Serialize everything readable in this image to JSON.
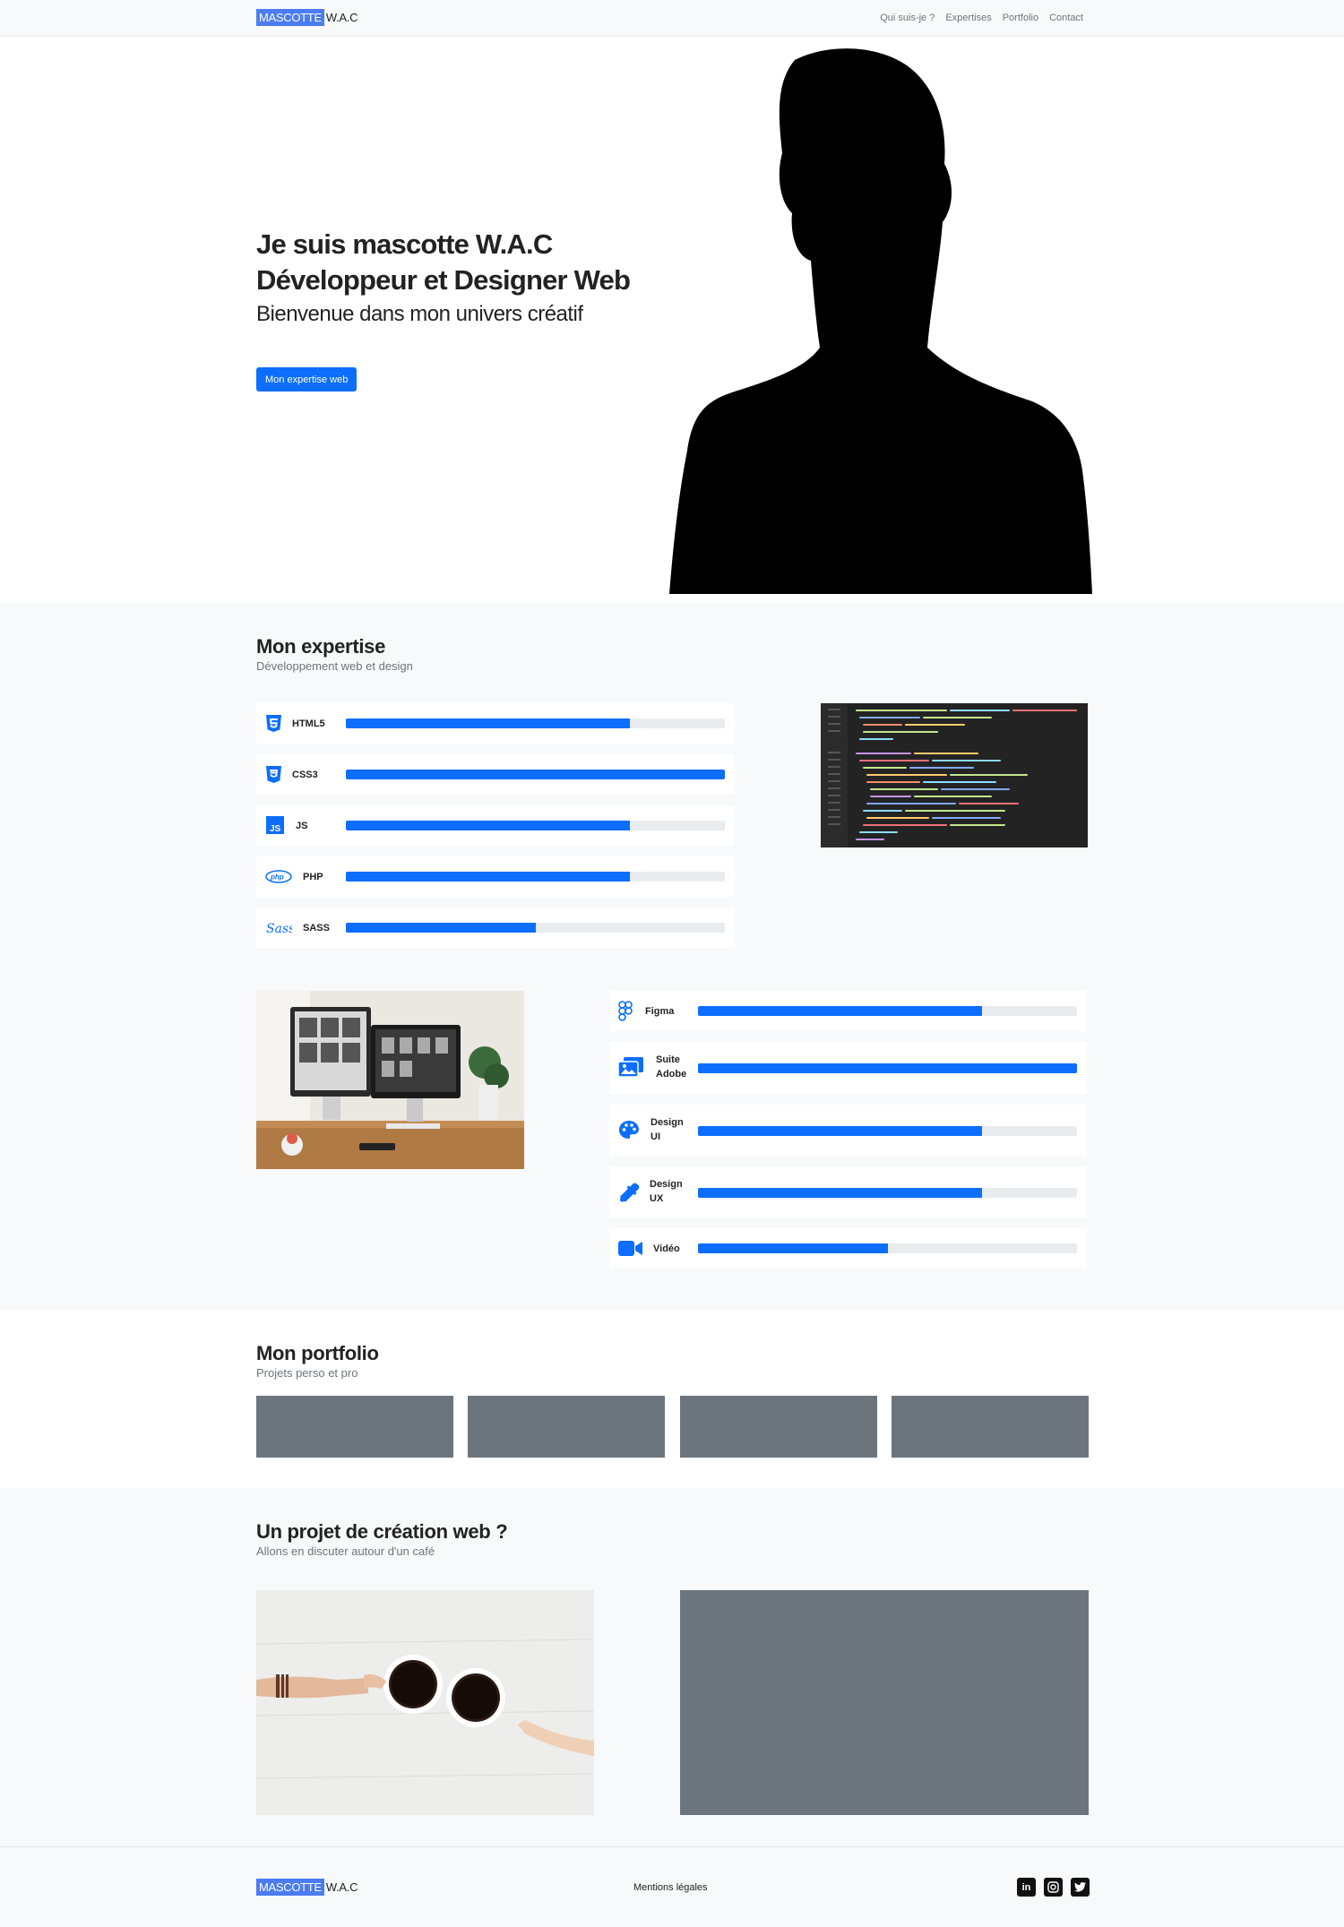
{
  "brand": {
    "highlight": "MASCOTTE",
    "rest": "W.A.C"
  },
  "nav": {
    "items": [
      "Qui suis-je ?",
      "Expertises",
      "Portfolio",
      "Contact"
    ]
  },
  "hero": {
    "title_line1": "Je suis mascotte W.A.C",
    "title_line2": "Développeur et Designer Web",
    "subtitle": "Bienvenue dans mon univers créatif",
    "button": "Mon expertise web"
  },
  "expertise": {
    "title": "Mon expertise",
    "subtitle": "Développement web et design",
    "dev_skills": [
      {
        "name": "HTML5",
        "icon": "html5-icon",
        "level": 0.75
      },
      {
        "name": "CSS3",
        "icon": "css3-icon",
        "level": 1.0
      },
      {
        "name": "JS",
        "icon": "js-icon",
        "level": 0.75
      },
      {
        "name": "PHP",
        "icon": "php-icon",
        "level": 0.75
      },
      {
        "name": "SASS",
        "icon": "sass-icon",
        "level": 0.5
      }
    ],
    "design_skills": [
      {
        "name": "Figma",
        "icon": "figma-icon",
        "level": 0.75
      },
      {
        "name": "Suite Adobe",
        "icon": "images-icon",
        "level": 1.0
      },
      {
        "name": "Design UI",
        "icon": "palette-icon",
        "level": 0.75
      },
      {
        "name": "Design UX",
        "icon": "eyedropper-icon",
        "level": 0.75
      },
      {
        "name": "Vidéo",
        "icon": "video-camera-icon",
        "level": 0.5
      }
    ]
  },
  "portfolio": {
    "title": "Mon portfolio",
    "subtitle": "Projets perso et pro",
    "tiles": 4
  },
  "contact": {
    "title": "Un projet de création web ?",
    "subtitle": "Allons en discuter autour d'un café"
  },
  "footer": {
    "legal": "Mentions légales",
    "socials": [
      "linkedin-icon",
      "instagram-icon",
      "twitter-icon"
    ]
  },
  "colors": {
    "accent": "#0d6efd",
    "brand_highlight": "#4b7cf2",
    "placeholder_grey": "#6c757d",
    "section_bg": "#f8f9fa"
  }
}
